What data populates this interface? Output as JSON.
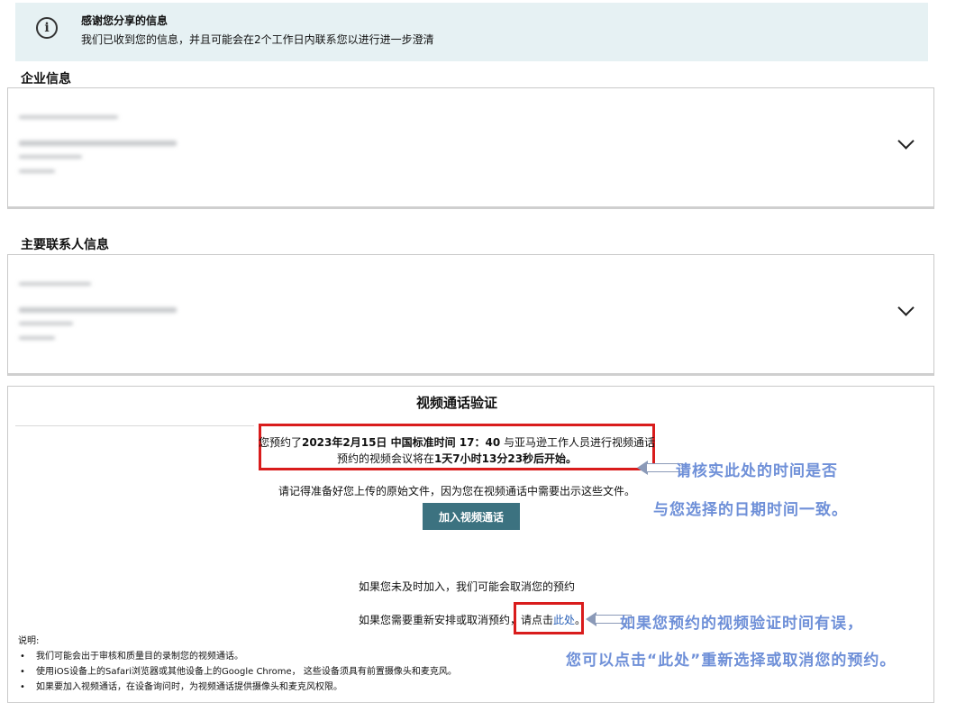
{
  "banner": {
    "title": "感谢您分享的信息",
    "body": "我们已收到您的信息，并且可能会在2个工作日内联系您以进行进一步澄清",
    "icon": "info-icon"
  },
  "sections": {
    "company": "企业信息",
    "contact": "主要联系人信息"
  },
  "video": {
    "title": "视频通话验证",
    "appt_prefix": "您预约了",
    "appt_time": "2023年2月15日 中国标准时间 17：40",
    "appt_suffix": " 与亚马逊工作人员进行视频通话",
    "start_prefix": "预约的视频会议将在",
    "start_countdown": "1天7小时13分23秒后开始。",
    "reminder": "请记得准备好您上传的原始文件，因为您在视频通话中需要出示这些文件。",
    "join_button": "加入视频通话",
    "cancel_notice": "如果您未及时加入，我们可能会取消您的预约",
    "reschedule_prefix": "如果您需要重新安排或取消预约，",
    "reschedule_click": "请点击",
    "reschedule_link": "此处",
    "reschedule_end": "。"
  },
  "notes": {
    "heading": "说明:",
    "items": [
      "我们可能会出于审核和质量目的录制您的视频通话。",
      "使用iOS设备上的Safari浏览器或其他设备上的Google Chrome， 这些设备须具有前置摄像头和麦克风。",
      "如果要加入视频通话，在设备询问时，为视频通话提供摄像头和麦克风权限。"
    ]
  },
  "annotations": {
    "time_check_line1": "请核实此处的时间是否",
    "time_check_line2": "与您选择的日期时间一致。",
    "reschedule_line1": "如果您预约的视频验证时间有误，",
    "reschedule_line2": "您可以点击“此处”重新选择或取消您的预约。"
  },
  "colors": {
    "banner_bg": "#e6f1f3",
    "button_bg": "#3c7280",
    "highlight_border": "#d91c1c",
    "annotation_text": "#6f90d8",
    "link": "#2b62b8"
  }
}
